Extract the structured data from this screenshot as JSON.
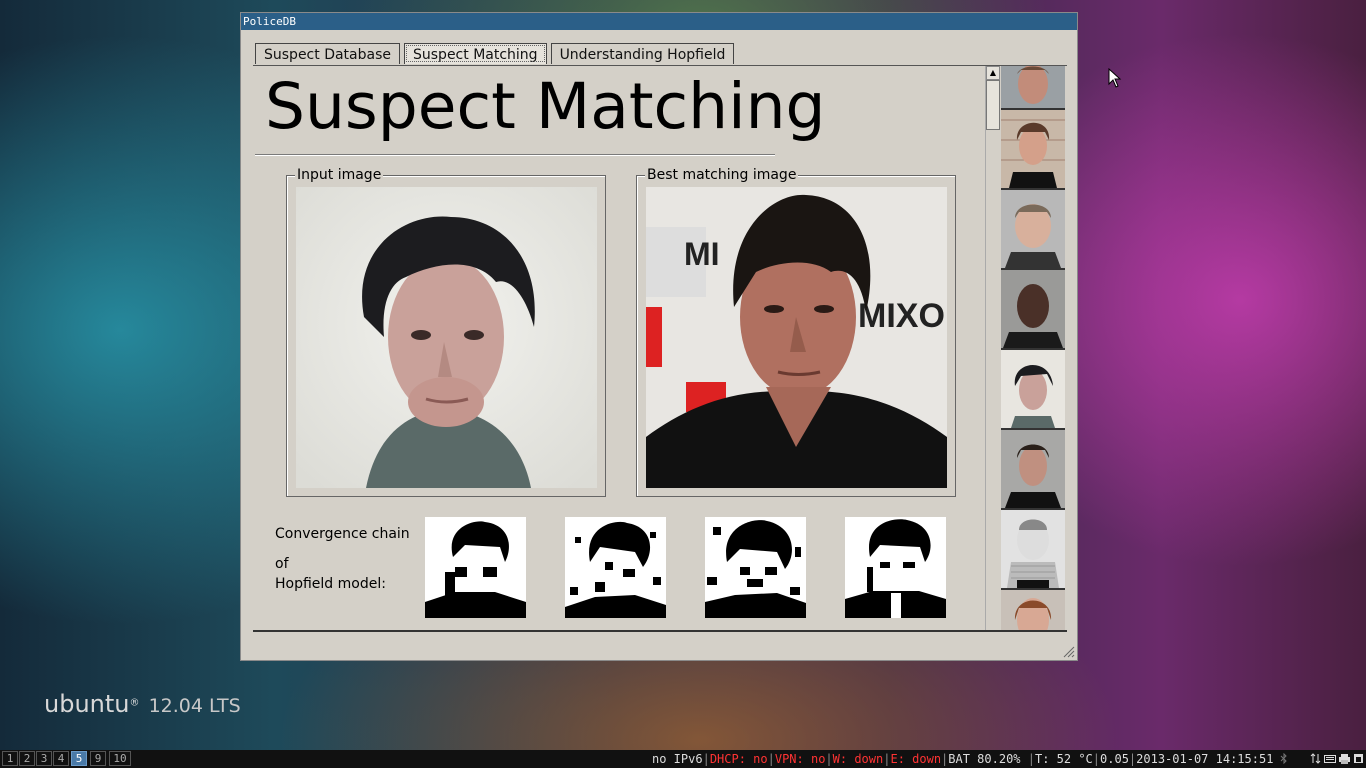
{
  "window": {
    "title": "PoliceDB"
  },
  "tabs": [
    {
      "label": "Suspect Database",
      "active": false
    },
    {
      "label": "Suspect Matching",
      "active": true
    },
    {
      "label": "Understanding Hopfield",
      "active": false
    }
  ],
  "main": {
    "title": "Suspect Matching",
    "input_label": "Input image",
    "match_label": "Best matching image",
    "convergence_line1": "Convergence chain",
    "convergence_line2": "of",
    "convergence_line3": "Hopfield model:"
  },
  "desktop": {
    "brand": "ubuntu",
    "version": "12.04 LTS"
  },
  "taskbar": {
    "workspaces": [
      {
        "label": "1",
        "active": false
      },
      {
        "label": "2",
        "active": false
      },
      {
        "label": "3",
        "active": false
      },
      {
        "label": "4",
        "active": false
      },
      {
        "label": "5",
        "active": true
      },
      {
        "label": "9",
        "active": false
      },
      {
        "label": "10",
        "active": false
      }
    ],
    "status": {
      "ipv6": "no IPv6",
      "dhcp": "DHCP: no",
      "vpn": "VPN: no",
      "wifi": "W: down",
      "eth": "E: down",
      "battery": "BAT 80.20%",
      "temp": "T: 52 °C",
      "load": "0.05",
      "datetime": "2013-01-07 14:15:51"
    }
  },
  "colors": {
    "titlebar": "#2b5f88",
    "window_bg": "#d4d0c8",
    "status_alert": "#ff3333",
    "workspace_active": "#4a7aa8"
  }
}
